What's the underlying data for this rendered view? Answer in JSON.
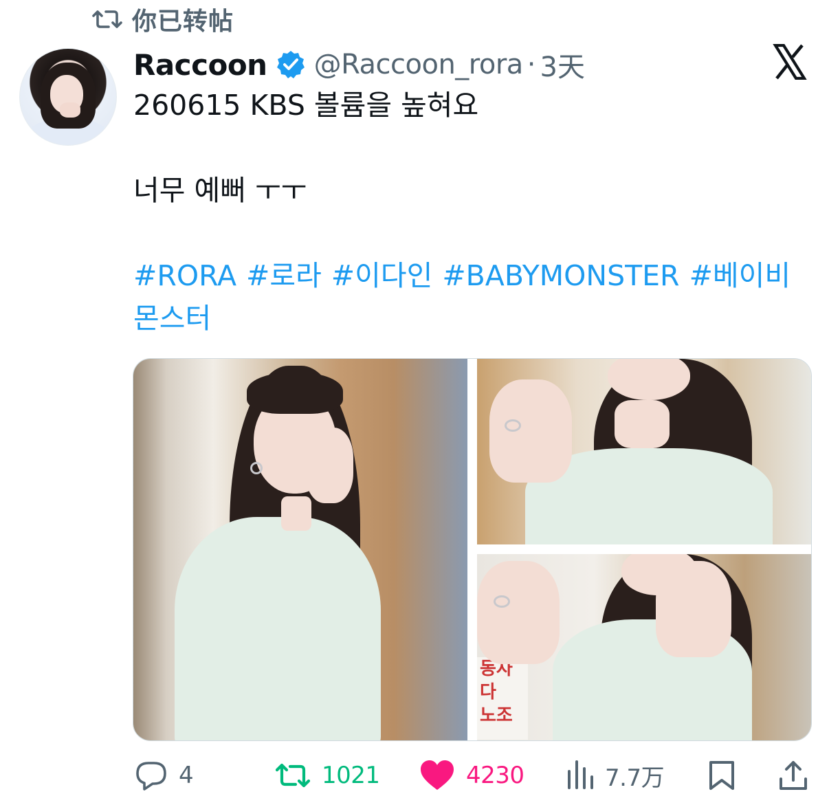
{
  "context": {
    "icon": "retweet-icon",
    "label": "你已转帖"
  },
  "author": {
    "display_name": "Raccoon",
    "verified": true,
    "handle": "@Raccoon_rora",
    "separator": "·",
    "time": "3天"
  },
  "tweet": {
    "line1": "260615 KBS 볼륨을 높혀요",
    "line2": "너무 예뻐 ㅜㅜ",
    "hashtags": [
      "#RORA",
      "#로라",
      "#이다인",
      "#BABYMONSTER",
      "#베이비몬스터"
    ]
  },
  "media": {
    "photos": [
      "photo-main",
      "photo-top-right",
      "photo-bottom-right"
    ]
  },
  "actions": {
    "reply_count": "4",
    "retweet_count": "1021",
    "like_count": "4230",
    "views_count": "7.7万"
  },
  "colors": {
    "link": "#1d9bf0",
    "retweet_active": "#00ba7c",
    "like_active": "#f91880",
    "secondary_text": "#536471",
    "verified_badge": "#1d9bf0"
  }
}
